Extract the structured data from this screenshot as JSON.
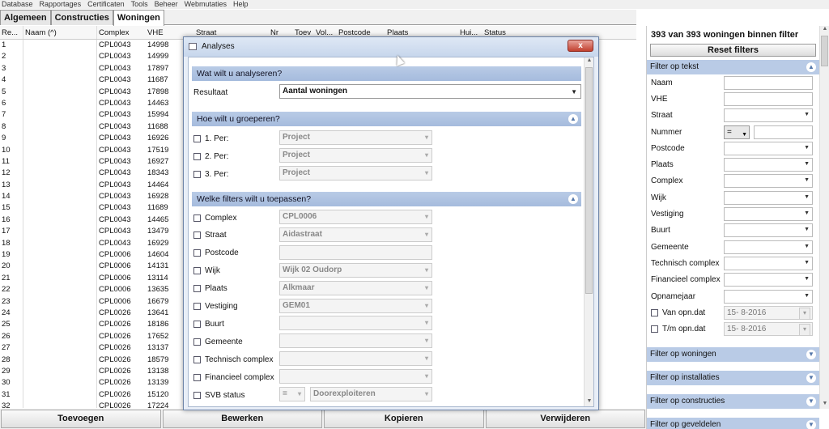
{
  "menu": [
    "Database",
    "Rapportages",
    "Certificaten",
    "Tools",
    "Beheer",
    "Webmutaties",
    "Help"
  ],
  "tabs": [
    {
      "label": "Algemeen",
      "active": false
    },
    {
      "label": "Constructies",
      "active": false
    },
    {
      "label": "Woningen",
      "active": true
    }
  ],
  "grid": {
    "headers": [
      "Re...",
      "Naam (^)",
      "Complex",
      "VHE",
      "Straat",
      "Nr",
      "Toev",
      "Vol...",
      "Postcode",
      "Plaats",
      "Hui...",
      "Status"
    ],
    "rows": [
      [
        "1",
        "CPL0043",
        "14998"
      ],
      [
        "2",
        "CPL0043",
        "14999"
      ],
      [
        "3",
        "CPL0043",
        "17897"
      ],
      [
        "4",
        "CPL0043",
        "11687"
      ],
      [
        "5",
        "CPL0043",
        "17898"
      ],
      [
        "6",
        "CPL0043",
        "14463"
      ],
      [
        "7",
        "CPL0043",
        "15994"
      ],
      [
        "8",
        "CPL0043",
        "11688"
      ],
      [
        "9",
        "CPL0043",
        "16926"
      ],
      [
        "10",
        "CPL0043",
        "17519"
      ],
      [
        "11",
        "CPL0043",
        "16927"
      ],
      [
        "12",
        "CPL0043",
        "18343"
      ],
      [
        "13",
        "CPL0043",
        "14464"
      ],
      [
        "14",
        "CPL0043",
        "16928"
      ],
      [
        "15",
        "CPL0043",
        "11689"
      ],
      [
        "16",
        "CPL0043",
        "14465"
      ],
      [
        "17",
        "CPL0043",
        "13479"
      ],
      [
        "18",
        "CPL0043",
        "16929"
      ],
      [
        "19",
        "CPL0006",
        "14604"
      ],
      [
        "20",
        "CPL0006",
        "14131"
      ],
      [
        "21",
        "CPL0006",
        "13114"
      ],
      [
        "22",
        "CPL0006",
        "13635"
      ],
      [
        "23",
        "CPL0006",
        "16679"
      ],
      [
        "24",
        "CPL0026",
        "13641"
      ],
      [
        "25",
        "CPL0026",
        "18186"
      ],
      [
        "26",
        "CPL0026",
        "17652"
      ],
      [
        "27",
        "CPL0026",
        "13137"
      ],
      [
        "28",
        "CPL0026",
        "18579"
      ],
      [
        "29",
        "CPL0026",
        "13138"
      ],
      [
        "30",
        "CPL0026",
        "13139"
      ],
      [
        "31",
        "CPL0026",
        "15120"
      ],
      [
        "32",
        "CPL0026",
        "17224"
      ]
    ]
  },
  "bottom_buttons": [
    "Toevoegen",
    "Bewerken",
    "Kopieren",
    "Verwijderen"
  ],
  "panel": {
    "title": "393 van 393 woningen binnen filter",
    "reset_label": "Reset filters",
    "text_section": "Filter op tekst",
    "fields": {
      "naam": "Naam",
      "vhe": "VHE",
      "straat": "Straat",
      "nummer": "Nummer",
      "postcode": "Postcode",
      "plaats": "Plaats",
      "complex": "Complex",
      "wijk": "Wijk",
      "vestiging": "Vestiging",
      "buurt": "Buurt",
      "gemeente": "Gemeente",
      "technisch": "Technisch complex",
      "financieel": "Financieel complex",
      "opnamejaar": "Opnamejaar",
      "van": "Van opn.dat",
      "tm": "T/m opn.dat"
    },
    "nummer_op": "=",
    "van_date": "15-  8-2016",
    "tm_date": "15-  8-2016",
    "sections": [
      "Filter op woningen",
      "Filter op installaties",
      "Filter op constructies",
      "Filter op geveldelen"
    ]
  },
  "dialog": {
    "title": "Analyses",
    "close": "x",
    "sec1": "Wat wilt u analyseren?",
    "resultaat_label": "Resultaat",
    "resultaat_value": "Aantal woningen",
    "sec2": "Hoe wilt u groeperen?",
    "per": [
      {
        "label": "1. Per:",
        "value": "Project"
      },
      {
        "label": "2. Per:",
        "value": "Project"
      },
      {
        "label": "3. Per:",
        "value": "Project"
      }
    ],
    "sec3": "Welke filters wilt u toepassen?",
    "filters": [
      {
        "label": "Complex",
        "value": "CPL0006",
        "arrow": true
      },
      {
        "label": "Straat",
        "value": "Aidastraat",
        "arrow": true
      },
      {
        "label": "Postcode",
        "value": "",
        "arrow": false
      },
      {
        "label": "Wijk",
        "value": "Wijk 02 Oudorp",
        "arrow": true
      },
      {
        "label": "Plaats",
        "value": "Alkmaar",
        "arrow": true
      },
      {
        "label": "Vestiging",
        "value": "GEM01",
        "arrow": true
      },
      {
        "label": "Buurt",
        "value": "",
        "arrow": true
      },
      {
        "label": "Gemeente",
        "value": "",
        "arrow": true
      },
      {
        "label": "Technisch complex",
        "value": "",
        "arrow": true
      },
      {
        "label": "Financieel complex",
        "value": "",
        "arrow": true
      }
    ],
    "svb_label": "SVB status",
    "svb_op": "=",
    "svb_value": "Doorexploiteren"
  }
}
